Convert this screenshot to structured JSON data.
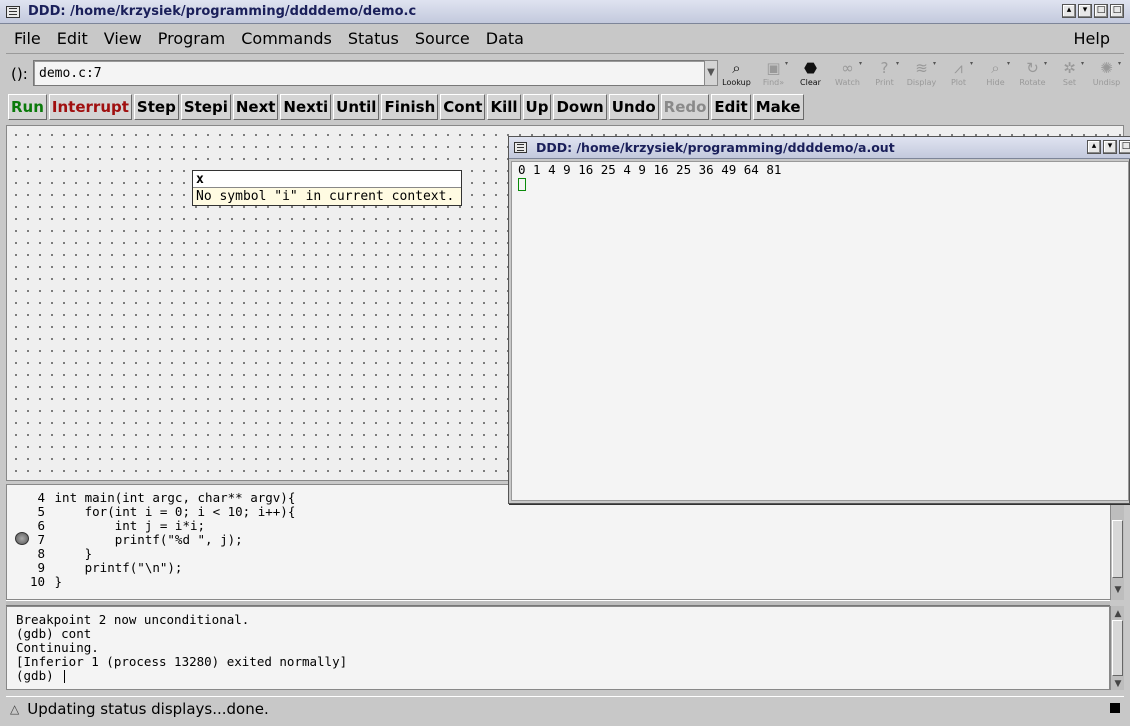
{
  "window": {
    "title": "DDD: /home/krzysiek/programming/ddddemo/demo.c"
  },
  "menubar": {
    "items": [
      {
        "label": "File"
      },
      {
        "label": "Edit"
      },
      {
        "label": "View"
      },
      {
        "label": "Program"
      },
      {
        "label": "Commands"
      },
      {
        "label": "Status"
      },
      {
        "label": "Source"
      },
      {
        "label": "Data"
      }
    ],
    "help": "Help"
  },
  "argument": {
    "label": "():",
    "value": "demo.c:7"
  },
  "toolbar": [
    {
      "label": "Lookup",
      "icon": "lookup-icon",
      "enabled": true
    },
    {
      "label": "Find»",
      "icon": "find-icon",
      "enabled": false
    },
    {
      "label": "Clear",
      "icon": "stop-icon",
      "enabled": true
    },
    {
      "label": "Watch",
      "icon": "watch-icon",
      "enabled": false
    },
    {
      "label": "Print",
      "icon": "print-icon",
      "enabled": false
    },
    {
      "label": "Display",
      "icon": "display-icon",
      "enabled": false
    },
    {
      "label": "Plot",
      "icon": "plot-icon",
      "enabled": false
    },
    {
      "label": "Hide",
      "icon": "hide-icon",
      "enabled": false
    },
    {
      "label": "Rotate",
      "icon": "rotate-icon",
      "enabled": false
    },
    {
      "label": "Set",
      "icon": "set-icon",
      "enabled": false
    },
    {
      "label": "Undisp",
      "icon": "undisp-icon",
      "enabled": false
    }
  ],
  "commands": [
    {
      "label": "Run"
    },
    {
      "label": "Interrupt"
    },
    {
      "label": "Step"
    },
    {
      "label": "Stepi"
    },
    {
      "label": "Next"
    },
    {
      "label": "Nexti"
    },
    {
      "label": "Until"
    },
    {
      "label": "Finish"
    },
    {
      "label": "Cont"
    },
    {
      "label": "Kill"
    },
    {
      "label": "Up"
    },
    {
      "label": "Down"
    },
    {
      "label": "Undo"
    },
    {
      "label": "Redo"
    },
    {
      "label": "Edit"
    },
    {
      "label": "Make"
    }
  ],
  "tooltip": {
    "name": "x",
    "message": "No symbol \"i\" in current context."
  },
  "source": {
    "lines": [
      {
        "num": "4",
        "code": " int main(int argc, char** argv){"
      },
      {
        "num": "5",
        "code": "     for(int i = 0; i < 10; i++){"
      },
      {
        "num": "6",
        "code": "         int j = i*i;"
      },
      {
        "num": "7",
        "code": "         printf(\"%d \", j);"
      },
      {
        "num": "8",
        "code": "     }"
      },
      {
        "num": "9",
        "code": "     printf(\"\\n\");"
      },
      {
        "num": "10",
        "code": " }"
      }
    ]
  },
  "console": {
    "lines": [
      "Breakpoint 2 now unconditional.",
      "(gdb) cont",
      "Continuing.",
      "[Inferior 1 (process 13280) exited normally]",
      "(gdb) "
    ]
  },
  "status": {
    "message": "Updating status displays...done."
  },
  "exec_window": {
    "title": "DDD: /home/krzysiek/programming/ddddemo/a.out",
    "output": "0 1 4 9 16 25 4 9 16 25 36 49 64 81"
  }
}
